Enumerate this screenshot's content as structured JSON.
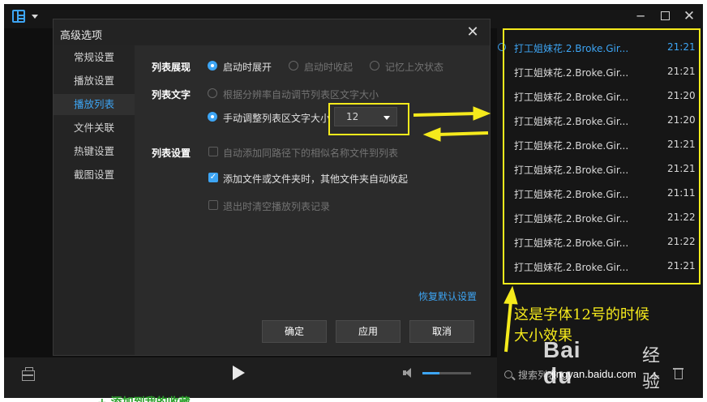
{
  "window": {
    "logo_icon": "playlist-logo-icon",
    "min_glyph": "─",
    "close_glyph": "✕"
  },
  "dialog": {
    "title": "高级选项",
    "close_glyph": "✕",
    "nav": [
      {
        "label": "常规设置",
        "active": false
      },
      {
        "label": "播放设置",
        "active": false
      },
      {
        "label": "播放列表",
        "active": true
      },
      {
        "label": "文件关联",
        "active": false
      },
      {
        "label": "热键设置",
        "active": false
      },
      {
        "label": "截图设置",
        "active": false
      }
    ],
    "sections": {
      "list_display": {
        "label": "列表展现",
        "options": [
          {
            "label": "启动时展开",
            "selected": true
          },
          {
            "label": "启动时收起",
            "selected": false
          },
          {
            "label": "记忆上次状态",
            "selected": false
          }
        ]
      },
      "list_text": {
        "label": "列表文字",
        "auto_option": "根据分辨率自动调节列表区文字大小",
        "manual_option": "手动调整列表区文字大小",
        "font_size_value": "12"
      },
      "list_settings": {
        "label": "列表设置",
        "checkboxes": [
          {
            "label": "自动添加同路径下的相似名称文件到列表",
            "checked": false,
            "enabled": false
          },
          {
            "label": "添加文件或文件夹时，其他文件夹自动收起",
            "checked": true,
            "enabled": true
          },
          {
            "label": "退出时清空播放列表记录",
            "checked": false,
            "enabled": false
          }
        ]
      }
    },
    "restore_link": "恢复默认设置",
    "buttons": {
      "ok": "确定",
      "apply": "应用",
      "cancel": "取消"
    }
  },
  "playlist": {
    "items": [
      {
        "title": "打工姐妹花.2.Broke.Gir...",
        "time": "21:21",
        "active": true
      },
      {
        "title": "打工姐妹花.2.Broke.Gir...",
        "time": "21:21",
        "active": false
      },
      {
        "title": "打工姐妹花.2.Broke.Gir...",
        "time": "21:20",
        "active": false
      },
      {
        "title": "打工姐妹花.2.Broke.Gir...",
        "time": "21:20",
        "active": false
      },
      {
        "title": "打工姐妹花.2.Broke.Gir...",
        "time": "21:21",
        "active": false
      },
      {
        "title": "打工姐妹花.2.Broke.Gir...",
        "time": "21:21",
        "active": false
      },
      {
        "title": "打工姐妹花.2.Broke.Gir...",
        "time": "21:11",
        "active": false
      },
      {
        "title": "打工姐妹花.2.Broke.Gir...",
        "time": "21:22",
        "active": false
      },
      {
        "title": "打工姐妹花.2.Broke.Gir...",
        "time": "21:22",
        "active": false
      },
      {
        "title": "打工姐妹花.2.Broke.Gir...",
        "time": "21:21",
        "active": false
      }
    ],
    "search_label": "搜索列表",
    "add_glyph": "+"
  },
  "player": {
    "volume_level": 0.35
  },
  "annotation": {
    "caption_line1": "这是字体12号的时候",
    "caption_line2": "大小效果",
    "color": "#f5ea1c"
  },
  "watermark": {
    "brand": "Bai du",
    "cn": "经验",
    "url": "jingyan.baidu.com"
  },
  "bottom_strip_text": "+ 添加到我的收藏"
}
